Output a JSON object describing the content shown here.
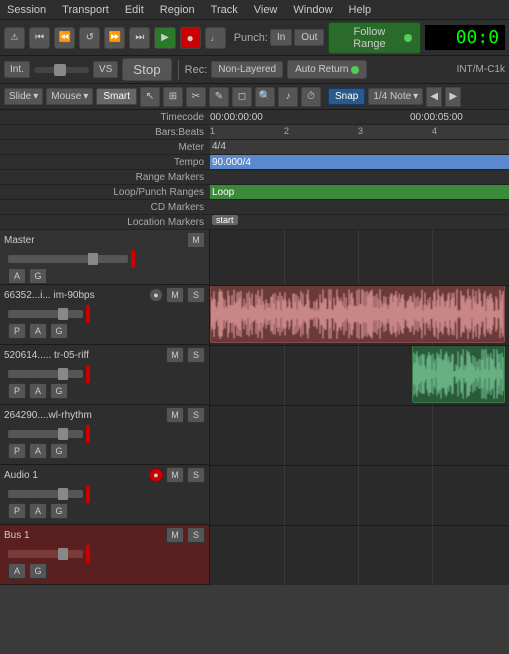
{
  "menu": {
    "items": [
      "Session",
      "Transport",
      "Edit",
      "Region",
      "Track",
      "View",
      "Window",
      "Help"
    ]
  },
  "transport": {
    "punch_label": "Punch:",
    "punch_in": "In",
    "punch_out": "Out",
    "follow_range": "Follow Range",
    "time_display": "00:0",
    "int_label": "Int.",
    "vs_label": "VS",
    "stop_label": "Stop",
    "rec_label": "Rec:",
    "layered_label": "Non-Layered",
    "auto_return_label": "Auto Return",
    "int_mk_label": "INT/M-C1k"
  },
  "toolbar": {
    "slide_label": "Slide",
    "mouse_label": "Mouse",
    "smart_label": "Smart",
    "snap_label": "Snap",
    "note_label": "1/4 Note"
  },
  "timeline": {
    "timecode_label": "Timecode",
    "timecode_val1": "00:00:00:00",
    "timecode_val2": "00:00:05:00",
    "bars_label": "Bars:Beats",
    "bar_marks": [
      "1",
      "2",
      "3",
      "4"
    ],
    "meter_label": "Meter",
    "meter_val": "4/4",
    "tempo_label": "Tempo",
    "tempo_val": "90.000/4",
    "range_markers_label": "Range Markers",
    "loop_punch_label": "Loop/Punch Ranges",
    "loop_val": "Loop",
    "cd_markers_label": "CD Markers",
    "location_markers_label": "Location Markers",
    "start_marker": "start"
  },
  "tracks": [
    {
      "name": "Master",
      "type": "master",
      "buttons": [
        "M"
      ],
      "fader_buttons": [
        "A",
        "G"
      ],
      "has_rec": false,
      "has_pag": false
    },
    {
      "name": "66352...i... im-90bps",
      "type": "audio",
      "buttons": [
        "M",
        "S"
      ],
      "fader_buttons": [
        "P",
        "A",
        "G"
      ],
      "has_rec": true,
      "rec_active": false,
      "waveform_type": "pink",
      "waveform_start": 0,
      "waveform_width": 295
    },
    {
      "name": "520614..... tr-05-riff",
      "type": "audio",
      "buttons": [
        "M",
        "S"
      ],
      "fader_buttons": [
        "P",
        "A",
        "G"
      ],
      "has_rec": false,
      "waveform_type": "green",
      "waveform_start": 200,
      "waveform_width": 95
    },
    {
      "name": "264290....wl-rhythm",
      "type": "audio",
      "buttons": [
        "M",
        "S"
      ],
      "fader_buttons": [
        "P",
        "A",
        "G"
      ],
      "has_rec": false,
      "waveform_type": "none"
    },
    {
      "name": "Audio 1",
      "type": "audio",
      "buttons": [
        "M",
        "S"
      ],
      "fader_buttons": [
        "P",
        "A",
        "G"
      ],
      "has_rec": true,
      "rec_active": true,
      "waveform_type": "none"
    },
    {
      "name": "Bus 1",
      "type": "bus",
      "buttons": [
        "M",
        "S"
      ],
      "fader_buttons": [
        "A",
        "G"
      ],
      "has_rec": false,
      "waveform_type": "none"
    }
  ],
  "colors": {
    "accent_blue": "#2a5a8a",
    "accent_green": "#2a7a2a",
    "accent_red": "#c00000",
    "waveform_pink": "#c87878",
    "waveform_green": "#5aaa7a",
    "bus_bg": "#5a2020"
  }
}
